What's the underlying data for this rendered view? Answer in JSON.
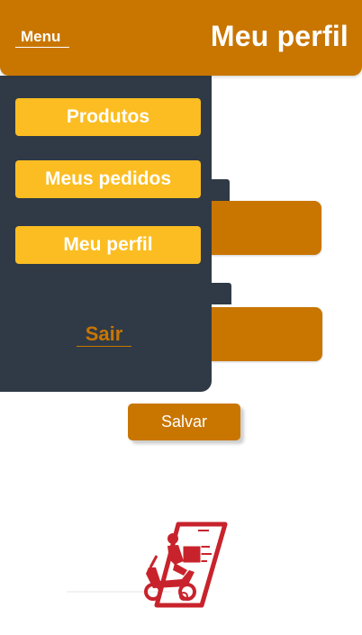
{
  "header": {
    "menu_label": "Menu",
    "title": "Meu perfil"
  },
  "drawer": {
    "items": [
      {
        "label": "Produtos"
      },
      {
        "label": "Meus pedidos"
      },
      {
        "label": "Meu perfil"
      }
    ],
    "logout_label": "Sair"
  },
  "form": {
    "save_label": "Salvar"
  },
  "colors": {
    "primary": "#c97600",
    "accent": "#fbbd22",
    "drawer_bg": "#2f3a46",
    "illustration": "#c8232c"
  },
  "illustration": {
    "icon": "delivery-scooter-phone-icon"
  }
}
